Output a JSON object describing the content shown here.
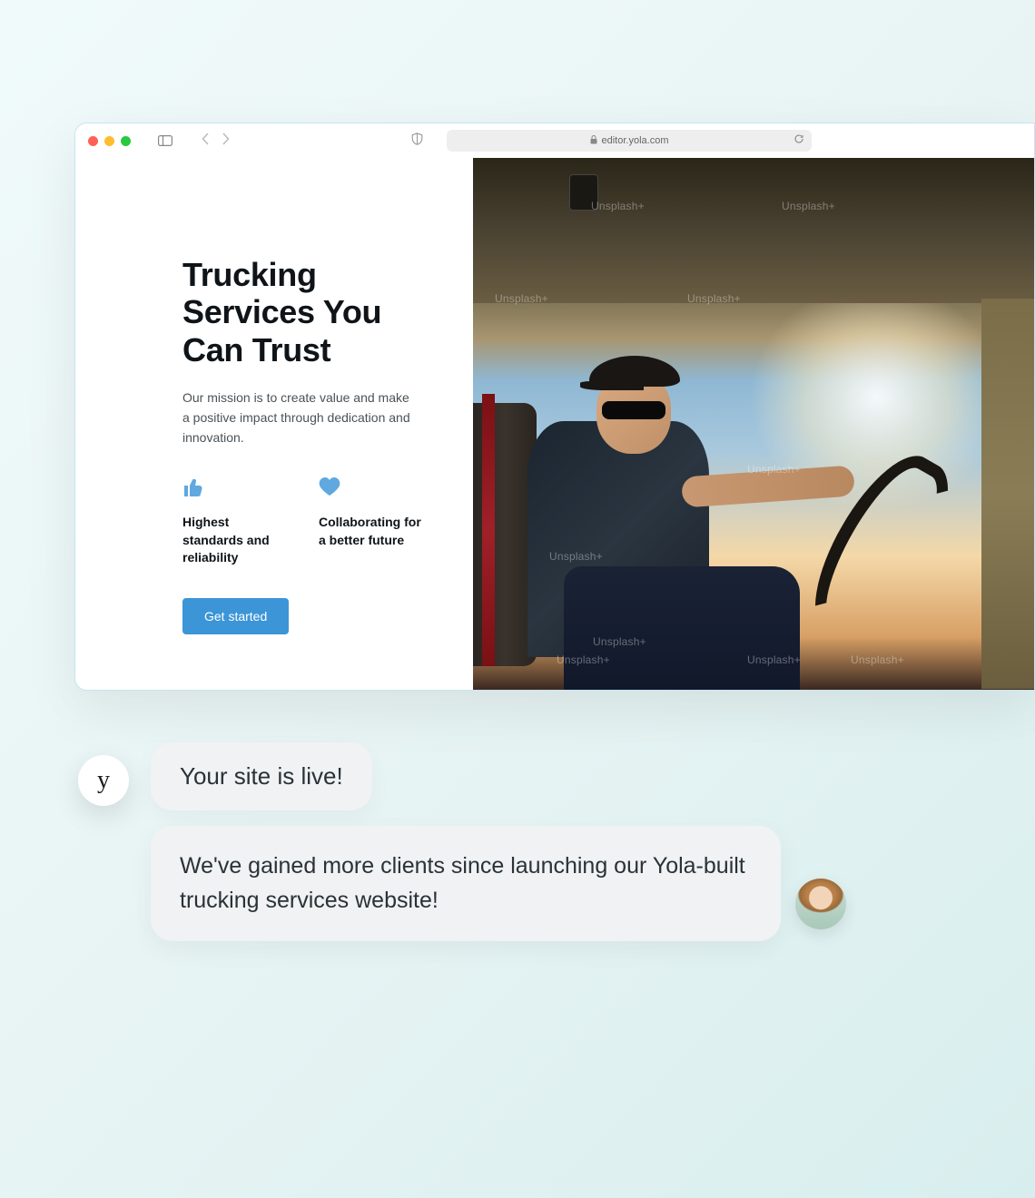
{
  "browser": {
    "url": "editor.yola.com"
  },
  "hero": {
    "title": "Trucking Services You Can Trust",
    "subtitle": "Our mission is to create value and make a positive impact through dedication and innovation.",
    "features": [
      {
        "label": "Highest standards and reliability",
        "icon": "thumbs-up-icon"
      },
      {
        "label": "Collaborating for a better future",
        "icon": "heart-icon"
      }
    ],
    "cta_label": "Get started"
  },
  "image": {
    "watermarks": [
      "Unsplash+",
      "Unsplash+",
      "Unsplash+",
      "Unsplash+",
      "Unsplash+",
      "Unsplash+",
      "Unsplash+",
      "Unsplash+",
      "Unsplash+",
      "Unsplash+"
    ]
  },
  "chat": {
    "badge": "y",
    "bubble1": "Your site is live!",
    "bubble2": "We've gained more clients since launching our Yola-built trucking services website!"
  },
  "colors": {
    "accent": "#3b95d7",
    "icon": "#5fa8e0"
  }
}
